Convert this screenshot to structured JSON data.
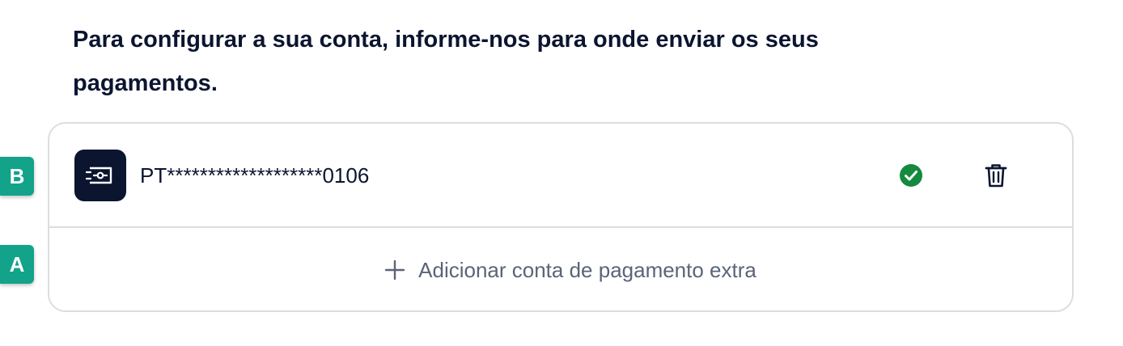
{
  "heading": "Para configurar a sua conta, informe-nos para onde enviar os seus pagamentos.",
  "account": {
    "iban_masked": "PT*******************0106",
    "icon": "bank-card-icon",
    "status_icon": "verified-check-icon",
    "status_color": "#15893e",
    "delete_icon": "trash-icon"
  },
  "add_account": {
    "icon": "plus-icon",
    "label": "Adicionar conta de pagamento extra"
  },
  "badges": {
    "b": "B",
    "a": "A"
  },
  "colors": {
    "primary_dark": "#0b1530",
    "badge": "#12a38a",
    "muted_text": "#5b6477",
    "border": "#dcdde0"
  }
}
